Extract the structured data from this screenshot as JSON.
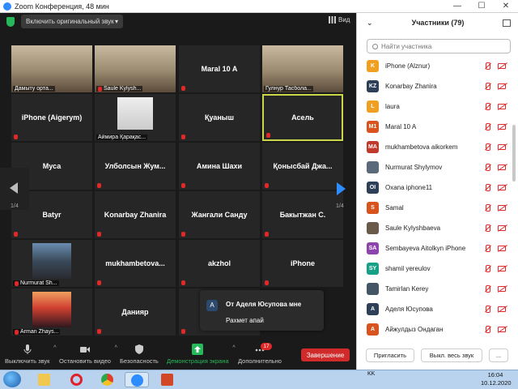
{
  "window": {
    "title": "Zoom Конференция, 48 мин",
    "minimize": "—",
    "maximize": "☐",
    "close": "✕"
  },
  "top_toolbar": {
    "original_sound": "Включить оригинальный звук",
    "view": "Вид"
  },
  "gallery": {
    "page_left": "1/4",
    "page_right": "1/4",
    "tiles": [
      {
        "label": "Дамыту орта...",
        "kind": "video",
        "muted": false
      },
      {
        "label": "Saule Kylysh...",
        "kind": "video",
        "muted": true
      },
      {
        "label": "Maral 10 A",
        "kind": "name",
        "muted": true
      },
      {
        "label": "Гулнур Тасбола...",
        "kind": "video",
        "muted": false
      },
      {
        "label": "iPhone (Aigerym)",
        "kind": "name",
        "muted": true
      },
      {
        "label": "Аймира Қарақас...",
        "kind": "avatar",
        "muted": false
      },
      {
        "label": "Қуаныш",
        "kind": "name",
        "muted": true
      },
      {
        "label": "Асель",
        "kind": "name",
        "muted": true,
        "active": true
      },
      {
        "label": "Муса",
        "kind": "name",
        "muted": true
      },
      {
        "label": "Улболсын  Жум...",
        "kind": "name",
        "muted": true
      },
      {
        "label": "Амина Шахи",
        "kind": "name",
        "muted": true
      },
      {
        "label": "Қонысбай  Джа...",
        "kind": "name",
        "muted": true
      },
      {
        "label": "Batyr",
        "kind": "name",
        "muted": true
      },
      {
        "label": "Konarbay Zhanira",
        "kind": "name",
        "muted": true
      },
      {
        "label": "Жангали Санду",
        "kind": "name",
        "muted": true
      },
      {
        "label": "Бакытжан С.",
        "kind": "name",
        "muted": true
      },
      {
        "label": "Nurmurat Sh...",
        "kind": "photo",
        "muted": true
      },
      {
        "label": "mukhambetova...",
        "kind": "name",
        "muted": true
      },
      {
        "label": "akzhol",
        "kind": "name",
        "muted": true
      },
      {
        "label": "iPhone",
        "kind": "name",
        "muted": true
      },
      {
        "label": "Arman Zhays...",
        "kind": "sunset",
        "muted": true
      },
      {
        "label": "Данияр",
        "kind": "name",
        "muted": true
      },
      {
        "label": "А",
        "kind": "name",
        "muted": true
      }
    ]
  },
  "chat_popup": {
    "avatar": "A",
    "from": "От Аделя Юсупова мне",
    "message": "Рахмет апай"
  },
  "bottom_toolbar": {
    "mute": "Выключить звук",
    "video": "Остановить видео",
    "security": "Безопасность",
    "share": "Демонстрация экрана",
    "more": "Дополнительно",
    "more_badge": "17",
    "end": "Завершение"
  },
  "participants_panel": {
    "title": "Участники (79)",
    "search_placeholder": "Найти участника",
    "invite": "Пригласить",
    "mute_all": "Выкл. весь звук",
    "more": "...",
    "items": [
      {
        "initials": "K",
        "name": "iPhone (Alznur)",
        "color": "#f0a020"
      },
      {
        "initials": "KZ",
        "name": "Konarbay Zhanira",
        "color": "#2e4057"
      },
      {
        "initials": "L",
        "name": "laura",
        "color": "#f0a020"
      },
      {
        "initials": "M1",
        "name": "Maral 10 A",
        "color": "#d9531e"
      },
      {
        "initials": "MA",
        "name": "mukhambetova aikorkem",
        "color": "#c0392b"
      },
      {
        "initials": "",
        "name": "Nurmurat Shylymov",
        "color": "#5a6a7a"
      },
      {
        "initials": "OI",
        "name": "Oxana iphone11",
        "color": "#2e4057"
      },
      {
        "initials": "S",
        "name": "Samal",
        "color": "#d9531e"
      },
      {
        "initials": "",
        "name": "Saule Kylyshbaeva",
        "color": "#6a5a4a"
      },
      {
        "initials": "SA",
        "name": "Sembayeva Aitolkyn iPhone",
        "color": "#8e44ad"
      },
      {
        "initials": "SY",
        "name": "shamil yereulov",
        "color": "#16a085"
      },
      {
        "initials": "",
        "name": "Tamirlan Kerey",
        "color": "#445566"
      },
      {
        "initials": "A",
        "name": "Аделя Юсупова",
        "color": "#2e4057"
      },
      {
        "initials": "A",
        "name": "Айжулдыз Ондаган",
        "color": "#d9531e"
      }
    ]
  },
  "taskbar": {
    "lang": "KK",
    "time": "16:04",
    "date": "10.12.2020"
  }
}
